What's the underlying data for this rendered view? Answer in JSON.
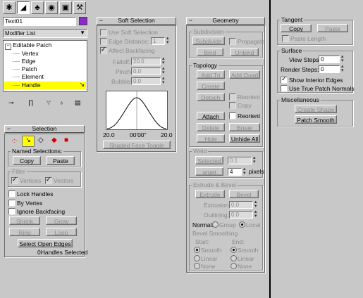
{
  "object_name": "Text01",
  "object_color": "#8a2bc8",
  "modifier_list_label": "Modifier List",
  "stack": {
    "root": "Editable Patch",
    "items": [
      "Vertex",
      "Edge",
      "Patch",
      "Element",
      "Handle"
    ],
    "selected_index": 4,
    "highlight_color": "#ffff00"
  },
  "selection": {
    "title": "Selection",
    "named_selections_label": "Named Selections:",
    "copy": "Copy",
    "paste": "Paste",
    "filter_label": "Filter",
    "vertices": "Vertices",
    "vectors": "Vectors",
    "lock_handles": "Lock Handles",
    "by_vertex": "By Vertex",
    "ignore_backfacing": "Ignore Backfacing",
    "shrink": "Shrink",
    "grow": "Grow",
    "ring": "Ring",
    "loop": "Loop",
    "select_open_edges": "Select Open Edges",
    "status": "0Handles Selected"
  },
  "soft_selection": {
    "title": "Soft Selection",
    "use_soft_selection": "Use Soft Selection",
    "edge_distance": "Edge Distance:",
    "edge_distance_value": "1",
    "affect_backfacing": "Affect Backfacing",
    "falloff": "Falloff:",
    "falloff_value": "20.0",
    "pinch": "Pinch:",
    "pinch_value": "0.0",
    "bubble": "Bubble:",
    "bubble_value": "0.0",
    "curve_left": "20.0",
    "curve_mid": "00'00\"",
    "curve_right": "20.0",
    "shaded_face_toggle": "Shaded Face Toggle"
  },
  "geometry": {
    "title": "Geometry",
    "subdivision_label": "Subdivision",
    "subdivide": "Subdivide",
    "propagate": "Propagate",
    "bind": "Bind",
    "unbind": "Unbind",
    "topology_label": "Topology",
    "add_tri": "Add Tri",
    "add_quad": "Add Quad",
    "create": "Create",
    "detach": "Detach",
    "reorient": "Reorient",
    "copy": "Copy",
    "attach": "Attach",
    "reorient2": "Reorient",
    "delete": "Delete",
    "break": "Break",
    "hide": "Hide",
    "unhide_all": "Unhide All",
    "weld_label": "Weld",
    "selected": "Selected",
    "selected_value": "0.1",
    "target": "arget",
    "target_value": "4",
    "pixels": "pixels",
    "extrude_label": "Extrude & Bevel",
    "extrude": "Extrude",
    "bevel": "Bevel",
    "extrusion": "Extrusion:",
    "extrusion_value": "0.0",
    "outlining": "Outlining:",
    "outlining_value": "0.0",
    "normal": "Normal:",
    "group": "Group",
    "local": "Local",
    "bevel_smoothing": "Bevel Smoothing",
    "start": "Start:",
    "end": "End:",
    "smooth": "Smooth",
    "linear": "Linear",
    "none": "None"
  },
  "right": {
    "tangent_label": "Tangent",
    "copy": "Copy",
    "paste": "Paste",
    "paste_length": "Paste Length",
    "surface_label": "Surface",
    "view_steps": "View Steps:",
    "view_steps_value": "0",
    "render_steps": "Render Steps:",
    "render_steps_value": "0",
    "show_interior_edges": "Show Interior Edges",
    "use_true_patch_normals": "Use True Patch Normals",
    "misc_label": "Miscellaneous",
    "create_shape": "Create Shape",
    "patch_smooth": "Patch Smooth"
  }
}
